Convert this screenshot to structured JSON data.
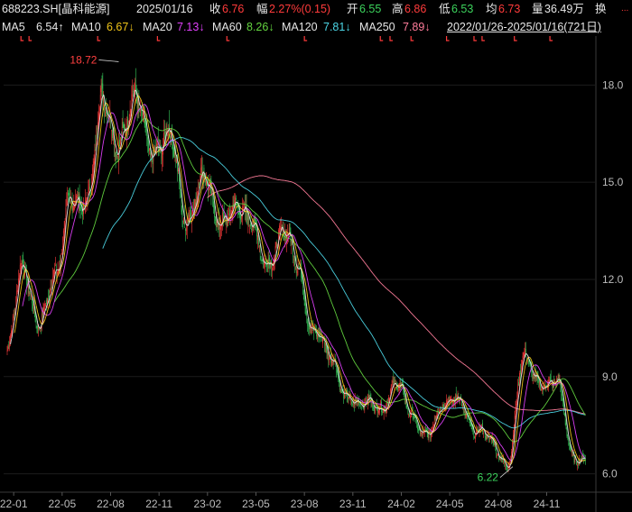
{
  "header": {
    "symbol": "688223.SH[晶科能源]",
    "date": "2025/01/16",
    "close_label": "收",
    "close": "6.76",
    "change_label": "幅",
    "change": "2.27%(0.15)",
    "open_label": "开",
    "open": "6.55",
    "high_label": "高",
    "high": "6.86",
    "low_label": "低",
    "low": "6.53",
    "avg_label": "均",
    "avg": "6.73",
    "vol_label": "量",
    "vol": "36.49万",
    "turn_label": "换",
    "more": "..."
  },
  "ma_bar": {
    "ma5_label": "MA5",
    "ma5": "6.54↑",
    "ma10_label": "MA10",
    "ma10": "6.67↓",
    "ma20_label": "MA20",
    "ma20": "7.13↓",
    "ma60_label": "MA60",
    "ma60": "8.26↓",
    "ma120_label": "MA120",
    "ma120": "7.81↓",
    "ma250_label": "MA250",
    "ma250": "7.89↓",
    "range": "2022/01/26-2025/01/16(721日)"
  },
  "colors": {
    "up": "#ff3b3b",
    "down": "#36c95a",
    "ma5": "#e6e6e6",
    "ma10": "#f0c419",
    "ma20": "#e040fb",
    "ma60": "#63d43f",
    "ma120": "#4cd6e6",
    "ma250": "#ff7d9b"
  },
  "chart_data": {
    "type": "candlestick",
    "ylim": [
      5.6,
      19.4
    ],
    "y_ticks": [
      "18.0",
      "15.0",
      "12.0",
      "9.0",
      "6.0"
    ],
    "y_tick_values": [
      18.0,
      15.0,
      12.0,
      9.0,
      6.0
    ],
    "x_ticks": [
      "22-01",
      "22-05",
      "22-08",
      "22-11",
      "23-02",
      "23-05",
      "23-08",
      "23-11",
      "24-02",
      "24-05",
      "24-08",
      "24-11"
    ],
    "annotations": [
      {
        "label": "18.72",
        "value": 18.72,
        "month": 6.9
      },
      {
        "label": "6.22",
        "value": 6.22,
        "month": 31.3
      }
    ],
    "monthly_close": [
      [
        0,
        9.8
      ],
      [
        1,
        12.2
      ],
      [
        2,
        10.9
      ],
      [
        3,
        11.8
      ],
      [
        4,
        14.9
      ],
      [
        5,
        14.3
      ],
      [
        6,
        17.6
      ],
      [
        7,
        16.4
      ],
      [
        8,
        17.2
      ],
      [
        9,
        16.3
      ],
      [
        10,
        16.2
      ],
      [
        11,
        14.0
      ],
      [
        12,
        15.2
      ],
      [
        13,
        13.6
      ],
      [
        14,
        14.6
      ],
      [
        15,
        13.5
      ],
      [
        16,
        12.8
      ],
      [
        17,
        13.3
      ],
      [
        18,
        12.4
      ],
      [
        19,
        10.5
      ],
      [
        20,
        9.4
      ],
      [
        21,
        8.6
      ],
      [
        22,
        8.0
      ],
      [
        23,
        8.1
      ],
      [
        24,
        8.8
      ],
      [
        25,
        7.7
      ],
      [
        26,
        7.4
      ],
      [
        27,
        7.9
      ],
      [
        28,
        8.5
      ],
      [
        29,
        7.2
      ],
      [
        30,
        7.0
      ],
      [
        31,
        6.4
      ],
      [
        32,
        9.4
      ],
      [
        33,
        9.0
      ],
      [
        34,
        8.7
      ],
      [
        35,
        6.6
      ]
    ],
    "series": [
      {
        "name": "MA5",
        "last": 6.54
      },
      {
        "name": "MA10",
        "last": 6.67
      },
      {
        "name": "MA20",
        "last": 7.13
      },
      {
        "name": "MA60",
        "last": 8.26
      },
      {
        "name": "MA120",
        "last": 7.81
      },
      {
        "name": "MA250",
        "last": 7.89
      }
    ]
  }
}
